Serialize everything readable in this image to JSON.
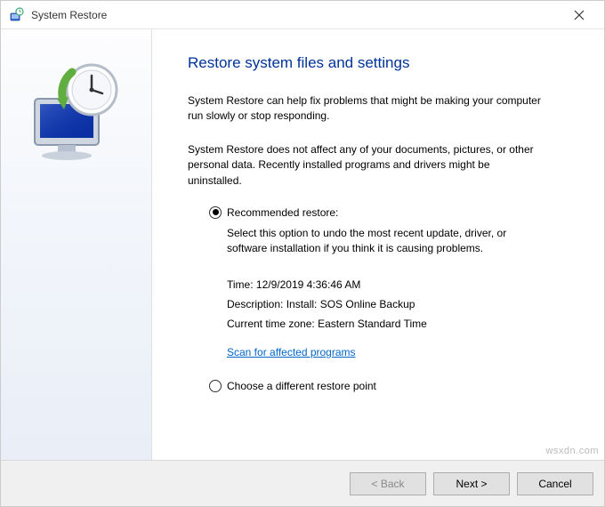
{
  "window": {
    "title": "System Restore"
  },
  "main": {
    "heading": "Restore system files and settings",
    "para1": "System Restore can help fix problems that might be making your computer run slowly or stop responding.",
    "para2": "System Restore does not affect any of your documents, pictures, or other personal data. Recently installed programs and drivers might be uninstalled."
  },
  "options": {
    "recommended": {
      "label": "Recommended restore:",
      "description": "Select this option to undo the most recent update, driver, or software installation if you think it is causing problems.",
      "time_label": "Time:",
      "time_value": "12/9/2019 4:36:46 AM",
      "desc_label": "Description:",
      "desc_value": "Install: SOS Online Backup",
      "tz_label": "Current time zone:",
      "tz_value": "Eastern Standard Time",
      "scan_link": "Scan for affected programs"
    },
    "choose_different": {
      "label": "Choose a different restore point"
    }
  },
  "footer": {
    "back": "< Back",
    "next": "Next >",
    "cancel": "Cancel"
  },
  "watermark": "wsxdn.com"
}
